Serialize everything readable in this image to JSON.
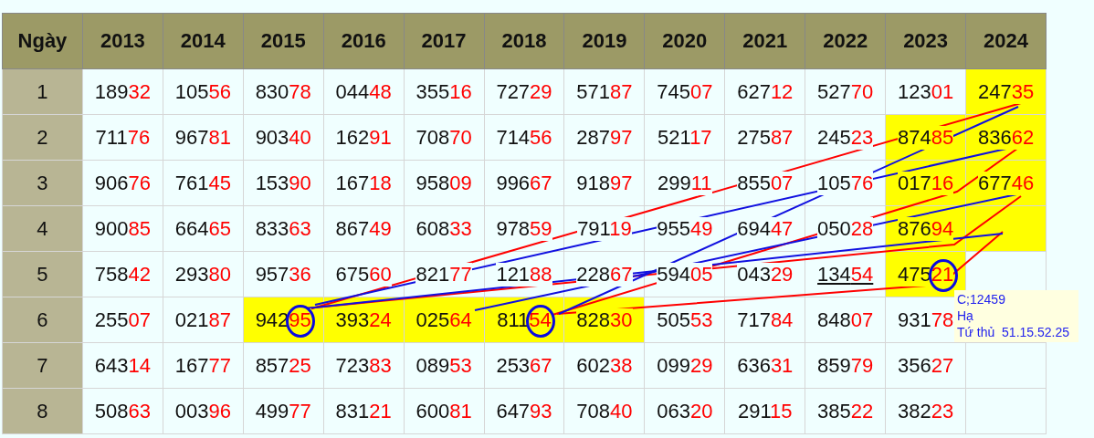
{
  "table": {
    "columns": [
      "Ngày",
      "2013",
      "2014",
      "2015",
      "2016",
      "2017",
      "2018",
      "2019",
      "2020",
      "2021",
      "2022",
      "2023",
      "2024"
    ],
    "rows": [
      {
        "cells": [
          {
            "kind": "day",
            "value": "1"
          },
          {
            "value": "18932"
          },
          {
            "value": "10556"
          },
          {
            "value": "83078"
          },
          {
            "value": "04448"
          },
          {
            "value": "35516"
          },
          {
            "value": "72729"
          },
          {
            "value": "57187"
          },
          {
            "value": "74507"
          },
          {
            "value": "62712"
          },
          {
            "value": "52770"
          },
          {
            "value": "12301"
          },
          {
            "value": "24735",
            "highlight": true
          }
        ]
      },
      {
        "cells": [
          {
            "kind": "day",
            "value": "2"
          },
          {
            "value": "71176"
          },
          {
            "value": "96781"
          },
          {
            "value": "90340"
          },
          {
            "value": "16291"
          },
          {
            "value": "70870"
          },
          {
            "value": "71456"
          },
          {
            "value": "28797"
          },
          {
            "value": "52117"
          },
          {
            "value": "27587"
          },
          {
            "value": "24523"
          },
          {
            "value": "87485",
            "highlight": true
          },
          {
            "value": "83662",
            "highlight": true
          }
        ]
      },
      {
        "cells": [
          {
            "kind": "day",
            "value": "3"
          },
          {
            "value": "90676"
          },
          {
            "value": "76145"
          },
          {
            "value": "15390"
          },
          {
            "value": "16718"
          },
          {
            "value": "95809"
          },
          {
            "value": "99667"
          },
          {
            "value": "91897"
          },
          {
            "value": "29911"
          },
          {
            "value": "85507"
          },
          {
            "value": "10576"
          },
          {
            "value": "01716",
            "highlight": true
          },
          {
            "value": "67746",
            "highlight": true
          }
        ]
      },
      {
        "cells": [
          {
            "kind": "day",
            "value": "4"
          },
          {
            "value": "90085"
          },
          {
            "value": "66465"
          },
          {
            "value": "83363"
          },
          {
            "value": "86749"
          },
          {
            "value": "60833"
          },
          {
            "value": "97859"
          },
          {
            "value": "79119"
          },
          {
            "value": "95549"
          },
          {
            "value": "69447"
          },
          {
            "value": "05028"
          },
          {
            "value": "87694",
            "highlight": true
          },
          {
            "highlight": true
          }
        ]
      },
      {
        "cells": [
          {
            "kind": "day",
            "value": "5"
          },
          {
            "value": "75842"
          },
          {
            "value": "29380"
          },
          {
            "value": "95736"
          },
          {
            "value": "67560"
          },
          {
            "value": "82177"
          },
          {
            "value": "12188"
          },
          {
            "value": "22867"
          },
          {
            "value": "59405"
          },
          {
            "value": "04329"
          },
          {
            "value": "13454",
            "underline": true
          },
          {
            "value": "47521",
            "highlight": true,
            "circled": true
          },
          {}
        ]
      },
      {
        "cells": [
          {
            "kind": "day",
            "value": "6"
          },
          {
            "value": "25507"
          },
          {
            "value": "02187"
          },
          {
            "value": "94295",
            "highlight": true,
            "circled": true
          },
          {
            "value": "39324",
            "highlight": true
          },
          {
            "value": "02564",
            "highlight": true
          },
          {
            "value": "81154",
            "highlight": true,
            "circled": true
          },
          {
            "value": "82830",
            "highlight": true
          },
          {
            "value": "50553"
          },
          {
            "value": "71784"
          },
          {
            "value": "84807"
          },
          {
            "value": "93178"
          },
          {}
        ]
      },
      {
        "cells": [
          {
            "kind": "day",
            "value": "7"
          },
          {
            "value": "64314"
          },
          {
            "value": "16777"
          },
          {
            "value": "85725"
          },
          {
            "value": "72383"
          },
          {
            "value": "08953"
          },
          {
            "value": "25367"
          },
          {
            "value": "60238"
          },
          {
            "value": "09929"
          },
          {
            "value": "63631"
          },
          {
            "value": "85979"
          },
          {
            "value": "35627"
          },
          {}
        ]
      },
      {
        "cells": [
          {
            "kind": "day",
            "value": "8"
          },
          {
            "value": "50863"
          },
          {
            "value": "00396"
          },
          {
            "value": "49977"
          },
          {
            "value": "83121"
          },
          {
            "value": "60081"
          },
          {
            "value": "64793"
          },
          {
            "value": "70840"
          },
          {
            "value": "06320"
          },
          {
            "value": "29115"
          },
          {
            "value": "38522"
          },
          {
            "value": "38223"
          },
          {}
        ]
      }
    ]
  },
  "tooltip": {
    "lines": [
      "C;12459",
      "Hạ",
      "Tứ thủ  51.15.52.25"
    ]
  }
}
